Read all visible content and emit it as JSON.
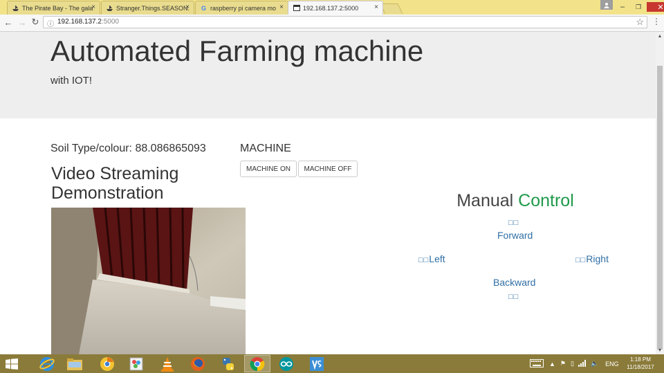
{
  "browser": {
    "tabs": [
      {
        "title": "The Pirate Bay - The gala",
        "close": "×"
      },
      {
        "title": "Stranger.Things.SEASON.",
        "close": "×"
      },
      {
        "title": "raspberry pi camera mo",
        "close": "×"
      },
      {
        "title": "192.168.137.2:5000",
        "close": "×"
      }
    ],
    "window_controls": {
      "minimize": "–",
      "restore": "❐",
      "close": "✕"
    },
    "url_host": "192.168.137.2",
    "url_port": ":5000"
  },
  "page": {
    "title": "Automated Farming machine",
    "subtitle": "with IOT!",
    "soil_reading": "Soil Type/colour: 88.086865093",
    "video_heading": "Video Streaming Demonstration",
    "machine": {
      "title": "MACHINE",
      "on_label": "MACHINE ON",
      "off_label": "MACHINE OFF"
    },
    "manual": {
      "title_part1": "Manual",
      "title_part2": "Control",
      "accent_color": "#1f9a4a",
      "forward_glyph": "□□",
      "forward": "Forward",
      "left_glyph": "□□",
      "left": "Left",
      "right_glyph": "□□",
      "right": "Right",
      "backward": "Backward",
      "backward_glyph": "□□"
    }
  },
  "taskbar": {
    "apps": [
      "windows-start-icon",
      "internet-explorer-icon",
      "file-explorer-icon",
      "chrome-canary-icon",
      "paint-icon",
      "vlc-icon",
      "firefox-icon",
      "python-icon",
      "chrome-icon",
      "arduino-icon",
      "visual-studio-icon"
    ],
    "language": "ENG",
    "time": "1:18 PM",
    "date": "11/18/2017"
  }
}
